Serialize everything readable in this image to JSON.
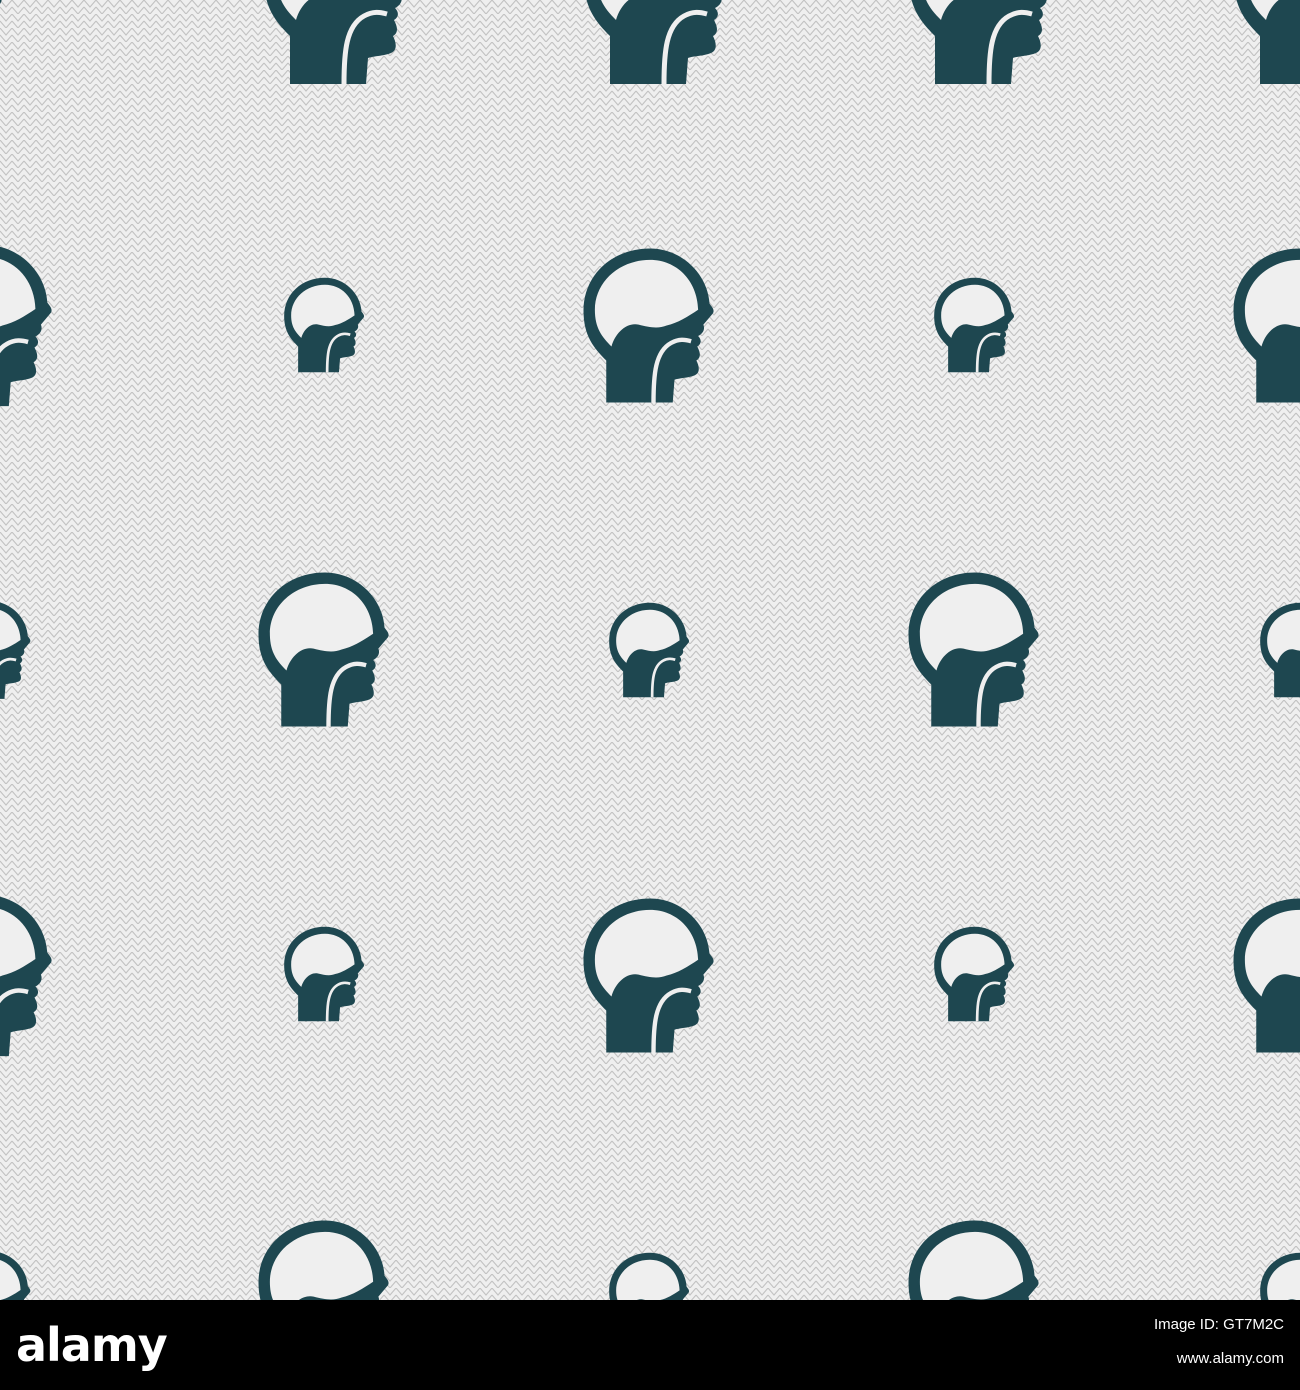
{
  "pattern": {
    "icon": "head-brain-throat-icon",
    "icon_color": "#1e4750",
    "background_color": "#efefef",
    "stripe_color": "#c2c2c2"
  },
  "watermark": {
    "logo": "alamy",
    "image_id": "Image ID: GT7M2C",
    "url": "www.alamy.com"
  }
}
